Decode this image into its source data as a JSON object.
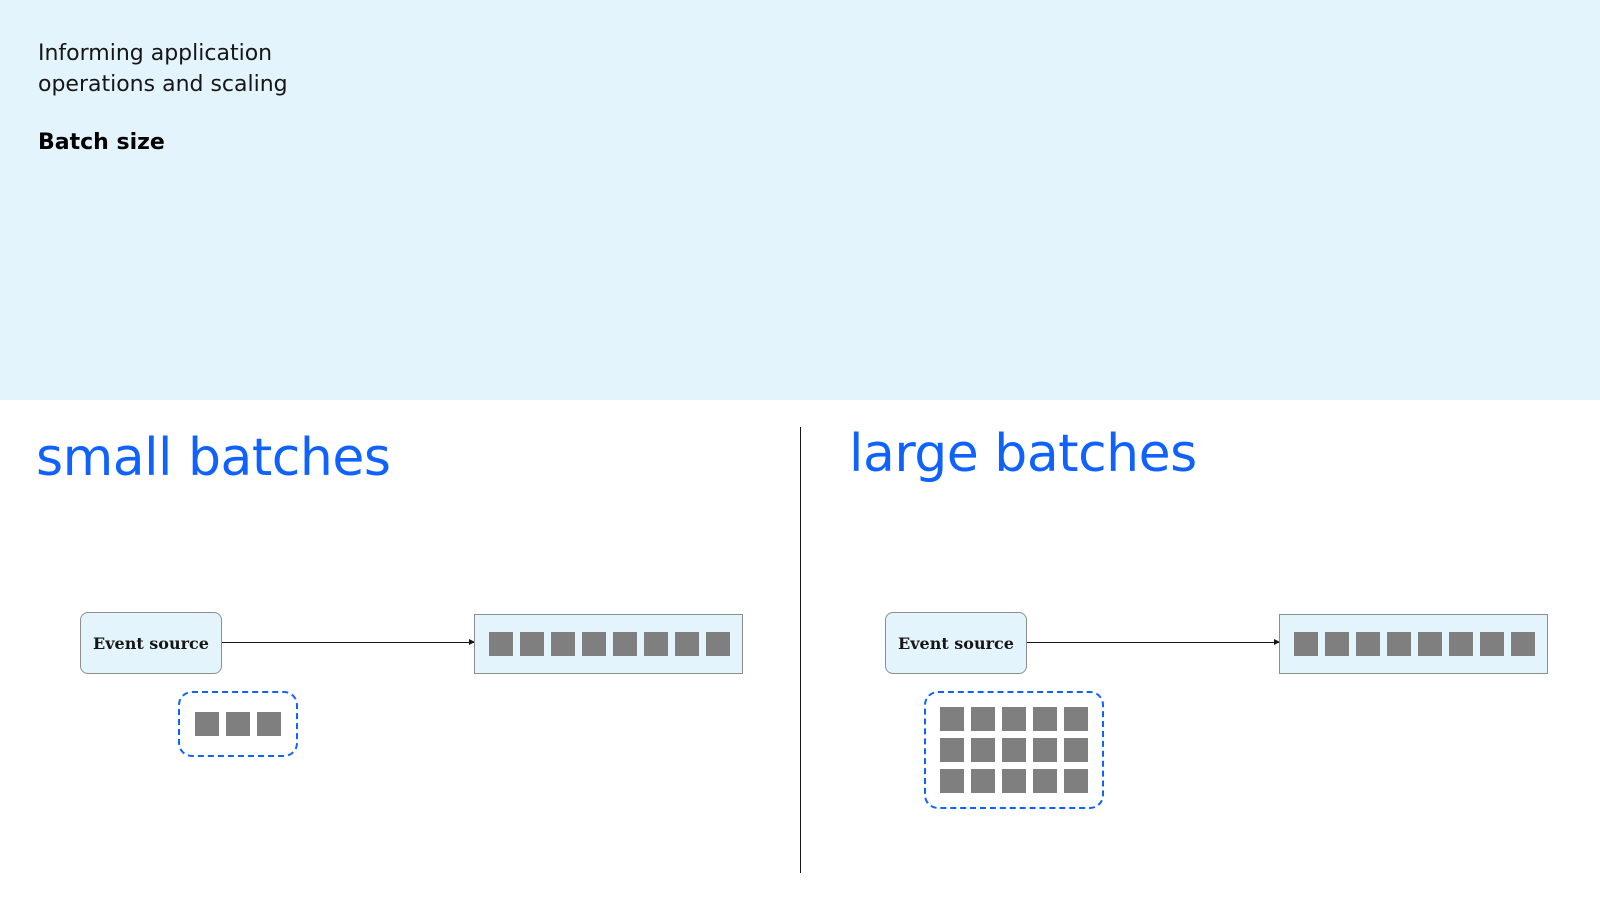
{
  "header": {
    "subtitle_line1": "Informing application",
    "subtitle_line2": "operations and scaling",
    "title": "Batch size",
    "background": "#e4f4fd"
  },
  "panels": [
    {
      "title": "small batches",
      "source_label": "Event source",
      "queue_event_count": 8,
      "batch": {
        "rows": 1,
        "cols": 3
      }
    },
    {
      "title": "large batches",
      "source_label": "Event source",
      "queue_event_count": 8,
      "batch": {
        "rows": 3,
        "cols": 5
      }
    }
  ],
  "colors": {
    "accent": "#0f62fe",
    "event_fill": "#7f7f7f",
    "box_fill": "#e4f4fd",
    "text": "#161616"
  }
}
